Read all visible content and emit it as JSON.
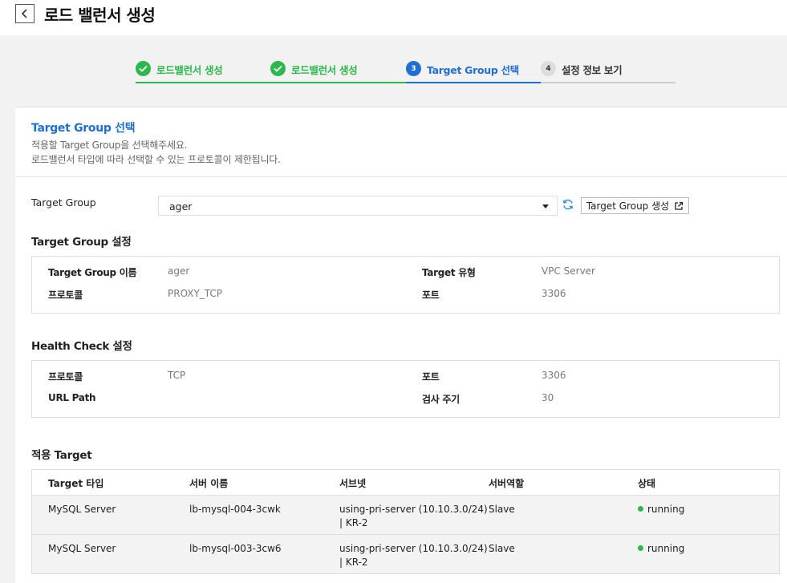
{
  "header": {
    "title": "로드 밸런서 생성"
  },
  "steps": [
    {
      "label": "로드밸런서 생성",
      "state": "done",
      "num": "1"
    },
    {
      "label": "로드밸런서 생성",
      "state": "done",
      "num": "2"
    },
    {
      "label": "Target Group 선택",
      "state": "active",
      "num": "3"
    },
    {
      "label": "설정 정보 보기",
      "state": "todo",
      "num": "4"
    }
  ],
  "section": {
    "title": "Target Group 선택",
    "desc1": "적용할 Target Group을 선택해주세요.",
    "desc2": "로드밸런서 타입에 따라 선택할 수 있는 프로토콜이 제한됩니다."
  },
  "target_group": {
    "label": "Target Group",
    "selected": "ager",
    "create_button": "Target Group 생성"
  },
  "tg_settings": {
    "title": "Target Group 설정",
    "name_k": "Target Group 이름",
    "name_v": "ager",
    "type_k": "Target 유형",
    "type_v": "VPC Server",
    "proto_k": "프로토콜",
    "proto_v": "PROXY_TCP",
    "port_k": "포트",
    "port_v": "3306"
  },
  "health": {
    "title": "Health Check 설정",
    "proto_k": "프로토콜",
    "proto_v": "TCP",
    "port_k": "포트",
    "port_v": "3306",
    "path_k": "URL Path",
    "path_v": "",
    "interval_k": "검사 주기",
    "interval_v": "30"
  },
  "targets": {
    "title": "적용 Target",
    "columns": [
      "Target 타입",
      "서버 이름",
      "서브넷",
      "서버역할",
      "상태"
    ],
    "rows": [
      {
        "type": "MySQL Server",
        "name": "lb-mysql-004-3cwk",
        "subnet1": "using-pri-server (10.10.3.0/24)",
        "subnet2": "| KR-2",
        "role": "Slave",
        "status": "running"
      },
      {
        "type": "MySQL Server",
        "name": "lb-mysql-003-3cw6",
        "subnet1": "using-pri-server (10.10.3.0/24)",
        "subnet2": "| KR-2",
        "role": "Slave",
        "status": "running"
      }
    ]
  },
  "colors": {
    "done": "#2db84d",
    "active": "#1f6fd1",
    "status_running": "#2db84d"
  }
}
